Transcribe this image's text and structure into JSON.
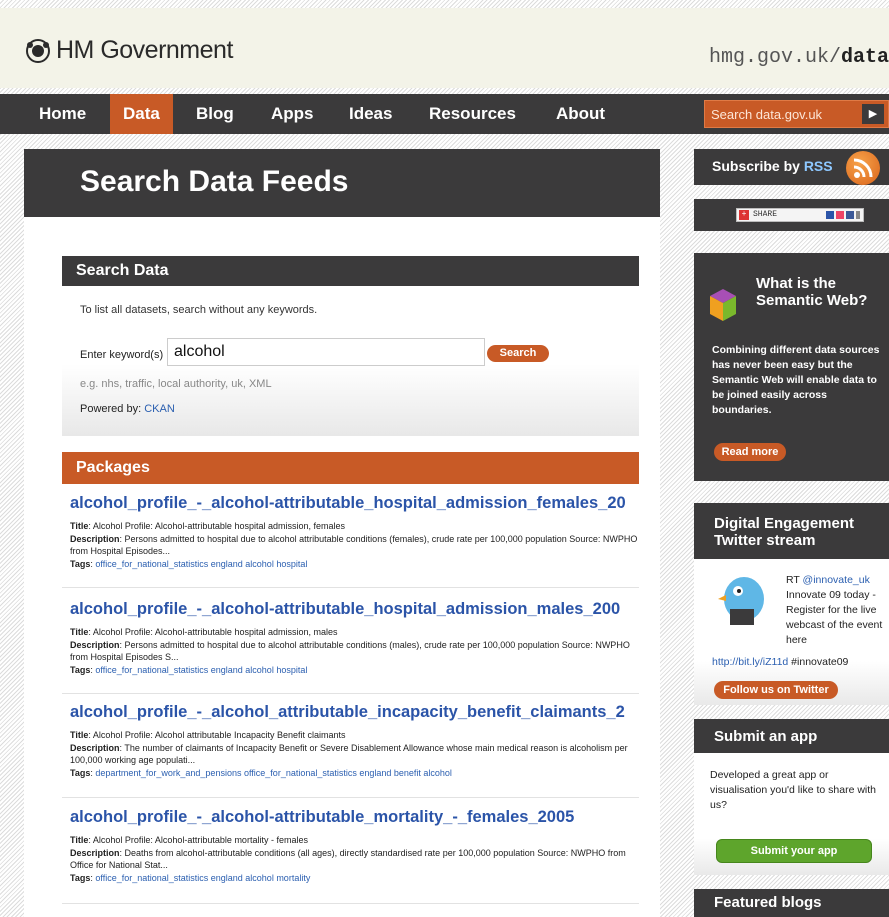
{
  "header": {
    "logo_text": "HM Government",
    "url_prefix": "hmg.gov.uk/",
    "url_bold": "data"
  },
  "nav": {
    "items": [
      "Home",
      "Data",
      "Blog",
      "Apps",
      "Ideas",
      "Resources",
      "About"
    ],
    "active": "Data",
    "search_placeholder": "Search data.gov.uk",
    "search_go_icon": "triangle-right-icon"
  },
  "page": {
    "title": "Search Data Feeds"
  },
  "search_panel": {
    "heading": "Search Data",
    "hint": "To list all datasets, search without any keywords.",
    "keyword_label": "Enter keyword(s)",
    "keyword_value": "alcohol",
    "search_button": "Search",
    "example": "e.g. nhs, traffic, local authority, uk, XML",
    "powered_label": "Powered by:",
    "powered_link": "CKAN"
  },
  "packages": {
    "heading": "Packages",
    "title_label": "Title",
    "description_label": "Description",
    "tags_label": "Tags",
    "items": [
      {
        "name": "alcohol_profile_-_alcohol-attributable_hospital_admission_females_20",
        "title": "Alcohol Profile: Alcohol-attributable hospital admission, females",
        "description": "Persons admitted to hospital due to alcohol attributable conditions (females), crude rate per 100,000 population Source: NWPHO from Hospital Episodes...",
        "tags": "office_for_national_statistics england alcohol hospital"
      },
      {
        "name": "alcohol_profile_-_alcohol-attributable_hospital_admission_males_200",
        "title": "Alcohol Profile: Alcohol-attributable hospital admission, males",
        "description": "Persons admitted to hospital due to alcohol attributable conditions (males), crude rate per 100,000 population Source: NWPHO from Hospital Episodes S...",
        "tags": "office_for_national_statistics england alcohol hospital"
      },
      {
        "name": "alcohol_profile_-_alcohol_attributable_incapacity_benefit_claimants_2",
        "title": "Alcohol Profile: Alcohol attributable Incapacity Benefit claimants",
        "description": "The number of claimants of Incapacity Benefit or Severe Disablement Allowance whose main medical reason is alcoholism per 100,000 working age populati...",
        "tags": "department_for_work_and_pensions office_for_national_statistics england benefit alcohol"
      },
      {
        "name": "alcohol_profile_-_alcohol-attributable_mortality_-_females_2005",
        "title": "Alcohol Profile: Alcohol-attributable mortality - females",
        "description": "Deaths from alcohol-attributable conditions (all ages), directly standardised rate per 100,000 population Source: NWPHO from Office for National Stat...",
        "tags": "office_for_national_statistics england alcohol mortality"
      }
    ]
  },
  "sidebar": {
    "rss_prefix": "Subscribe by ",
    "rss_word": "RSS",
    "share_label": "SHARE",
    "semantic_heading": "What is the Semantic Web?",
    "semantic_text": "Combining different data sources has never been easy but the Semantic Web will enable data to be joined easily across boundaries.",
    "read_more": "Read more",
    "twitter_heading": "Digital Engagement Twitter stream",
    "tweet_prefix": "RT ",
    "tweet_handle": "@innovate_uk",
    "tweet_text": " Innovate 09 today - Register for the live webcast of the event here",
    "tweet_url": "http://bit.ly/iZ11d",
    "tweet_hashtag": " #innovate09",
    "follow_button": "Follow us on Twitter",
    "app_heading": "Submit an app",
    "app_text": "Developed a great app or visualisation you'd like to share with us?",
    "submit_button": "Submit your app",
    "blogs_heading": "Featured blogs"
  },
  "colors": {
    "accent": "#c85a26",
    "dark": "#3b3a3b",
    "link": "#2b54a8",
    "green": "#5ea52c"
  }
}
